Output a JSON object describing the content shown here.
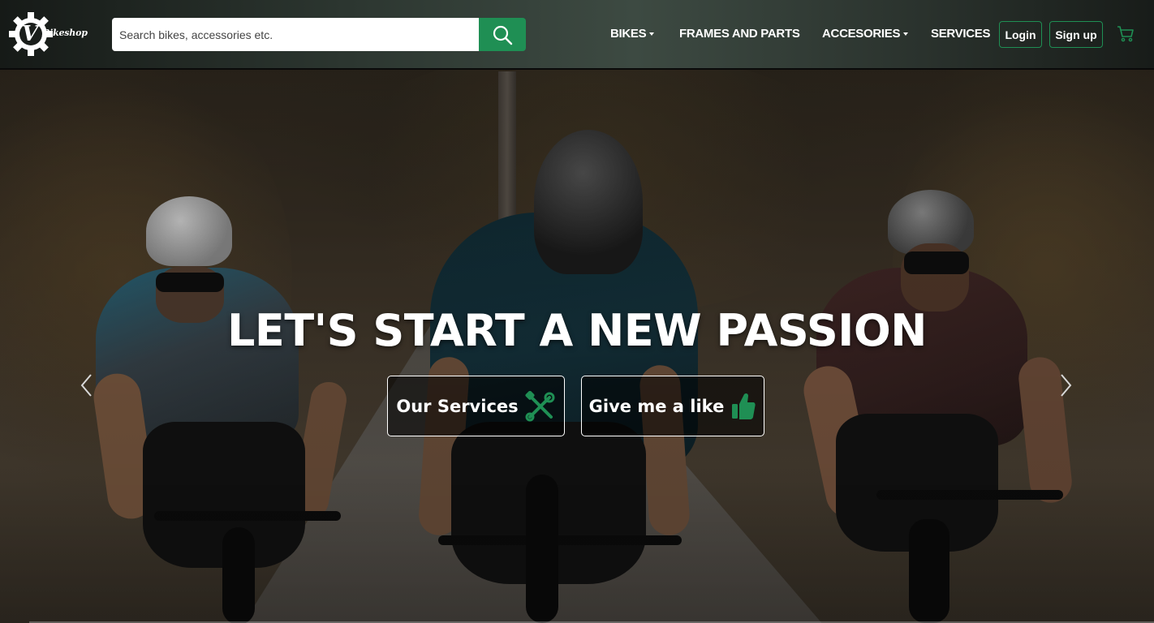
{
  "brand": {
    "logo_letter": "V",
    "logo_text": "Bikeshop"
  },
  "search": {
    "placeholder": "Search bikes, accessories etc."
  },
  "nav": {
    "items": [
      {
        "label": "BIKES",
        "dropdown": true
      },
      {
        "label": "FRAMES AND PARTS",
        "dropdown": false
      },
      {
        "label": "ACCESORIES",
        "dropdown": true
      },
      {
        "label": "SERVICES",
        "dropdown": false
      }
    ],
    "login_label": "Login",
    "signup_label": "Sign up"
  },
  "hero": {
    "headline": "LET'S START A NEW PASSION",
    "services_label": "Our Services",
    "like_label": "Give me a like"
  },
  "icons": {
    "search": "search-icon",
    "cart": "cart-icon",
    "services": "tools-icon",
    "like": "thumbs-up-icon",
    "prev": "chevron-left-icon",
    "next": "chevron-right-icon"
  },
  "colors": {
    "accent": "#1f8f54",
    "icon_green": "#1f8f54",
    "text": "#ffffff"
  }
}
